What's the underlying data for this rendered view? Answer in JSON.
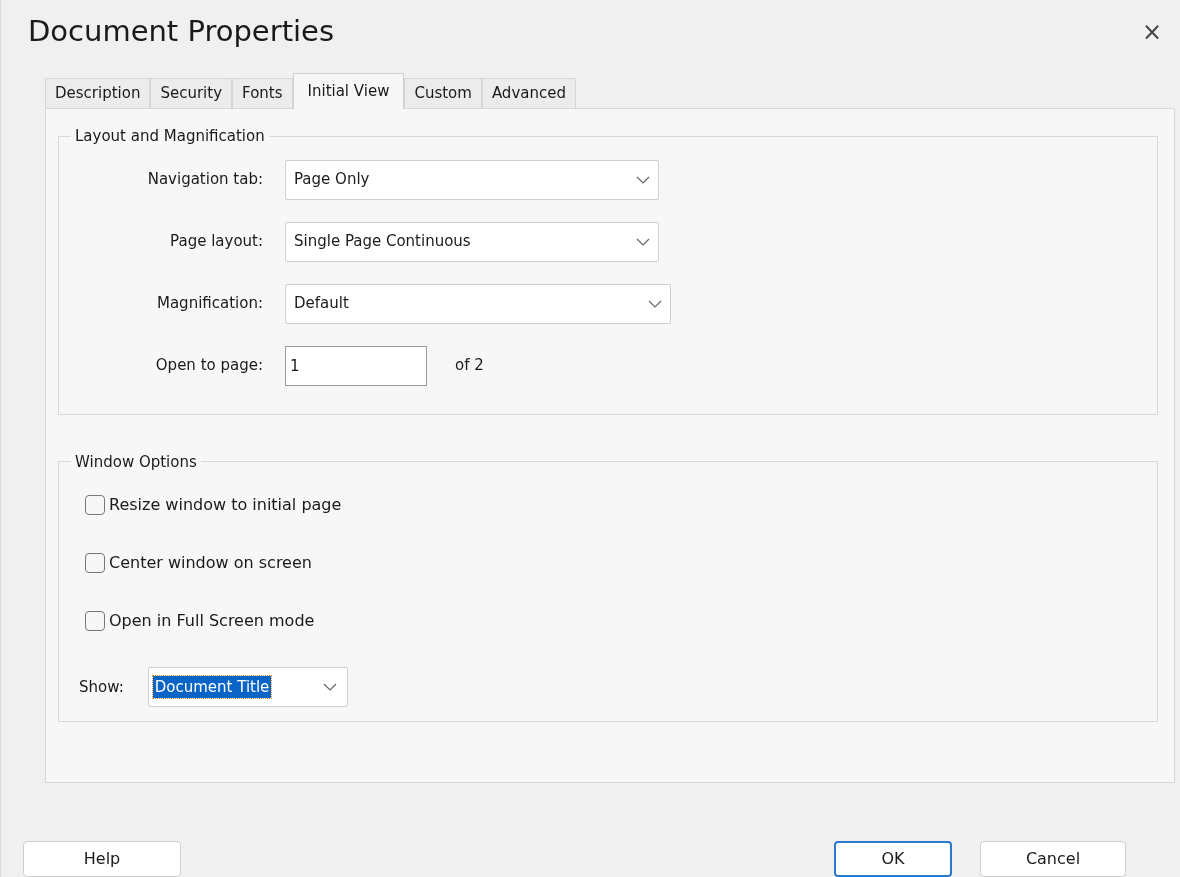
{
  "window": {
    "title": "Document Properties",
    "close": "×"
  },
  "tabs": [
    {
      "label": "Description",
      "selected": false
    },
    {
      "label": "Security",
      "selected": false
    },
    {
      "label": "Fonts",
      "selected": false
    },
    {
      "label": "Initial View",
      "selected": true
    },
    {
      "label": "Custom",
      "selected": false
    },
    {
      "label": "Advanced",
      "selected": false
    }
  ],
  "layout_group": {
    "title": "Layout and Magnification",
    "fields": [
      {
        "kind": "select",
        "label": "Navigation tab:",
        "value": "Page Only"
      },
      {
        "kind": "select",
        "label": "Page layout:",
        "value": "Single Page Continuous"
      },
      {
        "kind": "select",
        "label": "Magnification:",
        "value": "Default"
      },
      {
        "kind": "input",
        "label": "Open to page:",
        "value": "1",
        "suffix": "of 2"
      }
    ]
  },
  "window_group": {
    "title": "Window Options",
    "checkboxes": [
      {
        "label": "Resize window to initial page",
        "checked": false
      },
      {
        "label": "Center window on screen",
        "checked": false
      },
      {
        "label": "Open in Full Screen mode",
        "checked": false
      }
    ],
    "show": {
      "label": "Show:",
      "value": "Document Title",
      "highlighted": true
    }
  },
  "buttons": [
    {
      "label": "Help",
      "default": false
    },
    {
      "label": "OK",
      "default": true
    },
    {
      "label": "Cancel",
      "default": false
    }
  ]
}
